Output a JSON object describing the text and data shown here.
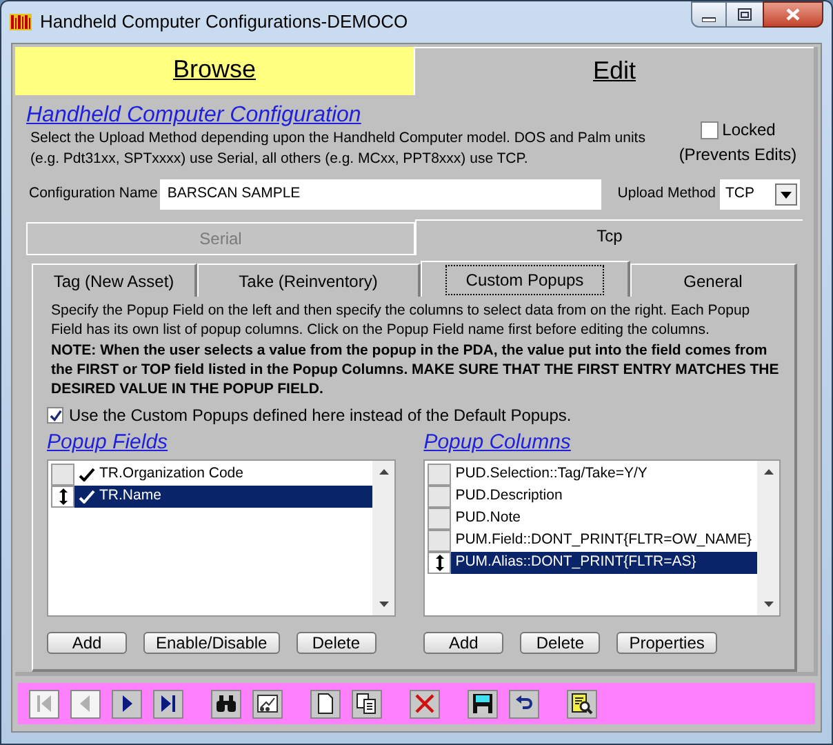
{
  "window": {
    "title": "Handheld Computer Configurations-DEMOCO"
  },
  "top_tabs": [
    {
      "label": "Browse",
      "selected": false
    },
    {
      "label": "Edit",
      "selected": true
    }
  ],
  "heading": "Handheld Computer Configuration",
  "description": "Select the Upload Method depending upon the Handheld Computer model. DOS and Palm units (e.g. Pdt31xx, SPTxxxx) use Serial, all others (e.g. MCxx, PPT8xxx) use TCP.",
  "locked": {
    "label": "Locked",
    "note": "(Prevents Edits)",
    "checked": false
  },
  "configuration_name": {
    "label": "Configuration Name",
    "value": "BARSCAN SAMPLE"
  },
  "upload_method": {
    "label": "Upload Method",
    "value": "TCP"
  },
  "method_tabs": [
    {
      "label": "Serial",
      "selected": false,
      "disabled": true
    },
    {
      "label": "Tcp",
      "selected": true,
      "disabled": false
    }
  ],
  "section_tabs": [
    {
      "label": "Tag (New Asset)",
      "selected": false
    },
    {
      "label": "Take (Reinventory)",
      "selected": false
    },
    {
      "label": "Custom Popups",
      "selected": true
    },
    {
      "label": "General",
      "selected": false
    }
  ],
  "instructions": "Specify the Popup Field on the left and then specify the columns to select data from on the right. Each Popup Field has its own list of popup columns. Click on the Popup Field name first before editing the columns.",
  "note": "NOTE: When the user selects a value from the popup in the PDA, the value put into the field comes from the FIRST or TOP field listed in the Popup Columns. MAKE SURE THAT THE FIRST ENTRY MATCHES THE DESIRED VALUE IN THE POPUP FIELD.",
  "use_custom": {
    "label": "Use the Custom Popups defined here instead of the Default Popups.",
    "checked": true
  },
  "popup_fields": {
    "heading": "Popup Fields",
    "items": [
      {
        "label": "TR.Organization Code",
        "enabled": true,
        "selected": false
      },
      {
        "label": "TR.Name",
        "enabled": true,
        "selected": true
      }
    ],
    "buttons": [
      "Add",
      "Enable/Disable",
      "Delete"
    ]
  },
  "popup_columns": {
    "heading": "Popup Columns",
    "items": [
      {
        "label": "PUD.Selection::Tag/Take=Y/Y",
        "selected": false
      },
      {
        "label": "PUD.Description",
        "selected": false
      },
      {
        "label": "PUD.Note",
        "selected": false
      },
      {
        "label": "PUM.Field::DONT_PRINT{FLTR=OW_NAME}",
        "selected": false
      },
      {
        "label": "PUM.Alias::DONT_PRINT{FLTR=AS}",
        "selected": true
      }
    ],
    "buttons": [
      "Add",
      "Delete",
      "Properties"
    ]
  },
  "toolbar": [
    {
      "kind": "first",
      "disabled": true
    },
    {
      "kind": "previous",
      "disabled": true
    },
    {
      "kind": "next",
      "disabled": false
    },
    {
      "kind": "last",
      "disabled": false
    },
    {
      "kind": "find",
      "disabled": false
    },
    {
      "kind": "report",
      "disabled": false
    },
    {
      "kind": "new",
      "disabled": false
    },
    {
      "kind": "copy",
      "disabled": false
    },
    {
      "kind": "delete",
      "disabled": false
    },
    {
      "kind": "save",
      "disabled": false
    },
    {
      "kind": "undo",
      "disabled": false
    },
    {
      "kind": "preview",
      "disabled": false
    }
  ]
}
